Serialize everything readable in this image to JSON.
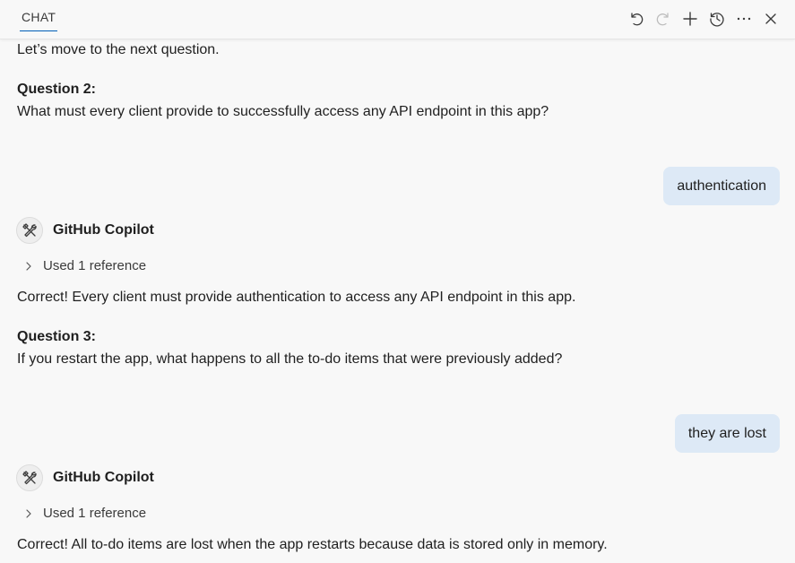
{
  "header": {
    "tab_label": "CHAT",
    "toolbar": {
      "undo_icon": "undo-icon",
      "redo_icon": "redo-icon",
      "new_chat_icon": "plus-icon",
      "history_icon": "history-icon",
      "more_icon": "ellipsis-icon",
      "close_icon": "close-icon"
    }
  },
  "messages": {
    "m0_text": "Let’s move to the next question.",
    "q2_heading": "Question 2:",
    "q2_text": "What must every client provide to successfully access any API endpoint in this app?",
    "user1": "authentication",
    "agent1": {
      "name": "GitHub Copilot",
      "reference": "Used 1 reference",
      "reply": "Correct! Every client must provide authentication to access any API endpoint in this app."
    },
    "q3_heading": "Question 3:",
    "q3_text": "If you restart the app, what happens to all the to-do items that were previously added?",
    "user2": "they are lost",
    "agent2": {
      "name": "GitHub Copilot",
      "reference": "Used 1 reference",
      "reply": "Correct! All to-do items are lost when the app restarts because data is stored only in memory."
    }
  },
  "colors": {
    "accent": "#005fb8",
    "user_bubble": "#dde9f6",
    "background": "#f8f8f8"
  }
}
